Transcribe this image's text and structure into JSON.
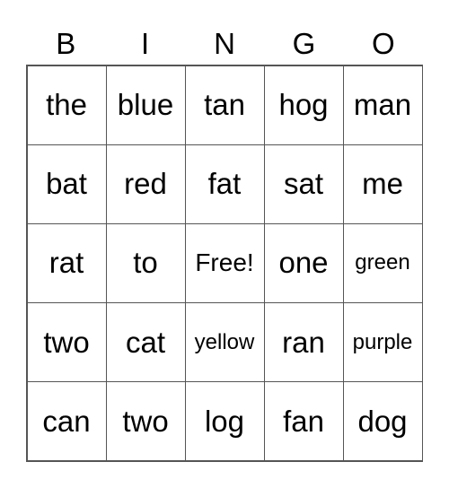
{
  "header": [
    "B",
    "I",
    "N",
    "G",
    "O"
  ],
  "cells": [
    [
      "the",
      "blue",
      "tan",
      "hog",
      "man"
    ],
    [
      "bat",
      "red",
      "fat",
      "sat",
      "me"
    ],
    [
      "rat",
      "to",
      "Free!",
      "one",
      "green"
    ],
    [
      "two",
      "cat",
      "yellow",
      "ran",
      "purple"
    ],
    [
      "can",
      "two",
      "log",
      "fan",
      "dog"
    ]
  ]
}
